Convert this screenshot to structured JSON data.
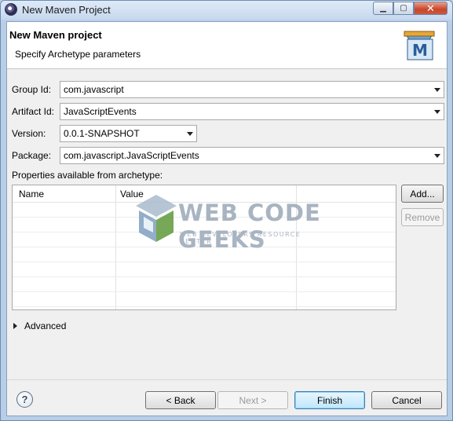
{
  "window": {
    "title": "New Maven Project",
    "controls": [
      "minimize",
      "maximize",
      "close"
    ]
  },
  "header": {
    "title": "New Maven project",
    "subtitle": "Specify Archetype parameters",
    "icon_letter": "M"
  },
  "form": {
    "group_id_label": "Group Id:",
    "group_id_value": "com.javascript",
    "artifact_id_label": "Artifact Id:",
    "artifact_id_value": "JavaScriptEvents",
    "version_label": "Version:",
    "version_value": "0.0.1-SNAPSHOT",
    "package_label": "Package:",
    "package_value": "com.javascript.JavaScriptEvents"
  },
  "properties": {
    "label": "Properties available from archetype:",
    "columns": [
      "Name",
      "Value"
    ],
    "rows": [],
    "add_label": "Add...",
    "remove_label": "Remove"
  },
  "advanced_label": "Advanced",
  "watermark": {
    "text": "WEB CODE GEEKS",
    "sub": "WEB DEVELOPERS RESOURCE CENTER"
  },
  "footer": {
    "help_label": "?",
    "back_label": "< Back",
    "next_label": "Next >",
    "finish_label": "Finish",
    "cancel_label": "Cancel"
  },
  "colors": {
    "titlebar": "#c6d8ee",
    "close_button": "#c7462b",
    "default_button": "#bee6fd"
  }
}
